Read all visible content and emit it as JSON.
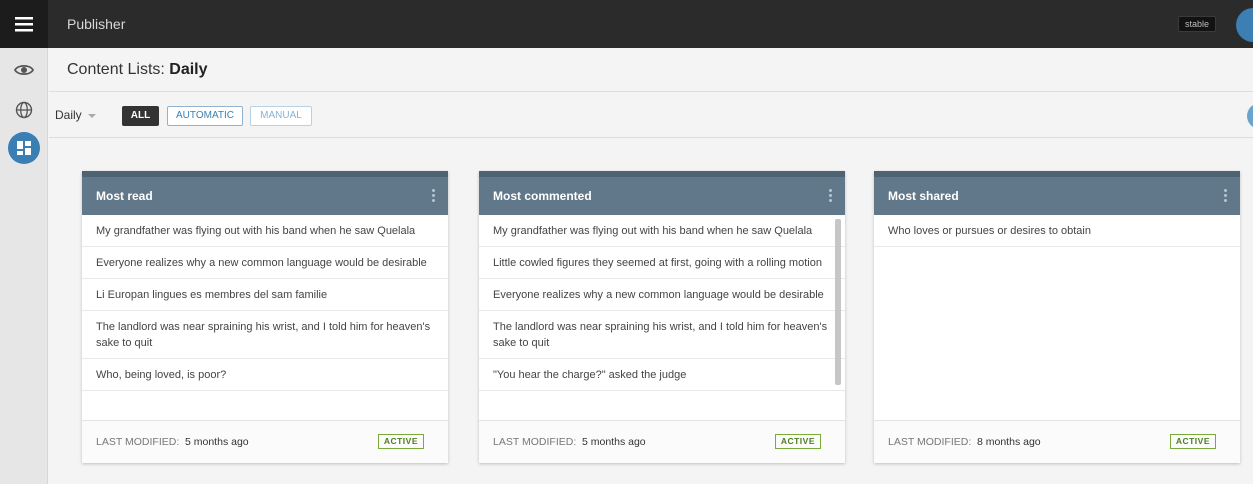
{
  "header": {
    "app_title": "Publisher",
    "env_badge": "stable"
  },
  "page": {
    "title_prefix": "Content Lists: ",
    "title_bold": "Daily"
  },
  "filters": {
    "selected_list": "Daily",
    "buttons": [
      {
        "label": "ALL",
        "active": true
      },
      {
        "label": "AUTOMATIC",
        "active": false
      },
      {
        "label": "MANUAL",
        "active": false,
        "disabled": true
      }
    ]
  },
  "cards": [
    {
      "title": "Most read",
      "items": [
        "My grandfather was flying out with his band when he saw Quelala",
        "Everyone realizes why a new common language would be desirable",
        "Li Europan lingues es membres del sam familie",
        "The landlord was near spraining his wrist, and I told him for heaven's sake to quit",
        "Who, being loved, is poor?"
      ],
      "last_modified_label": "LAST MODIFIED:",
      "last_modified_value": "5 months ago",
      "status": "ACTIVE"
    },
    {
      "title": "Most commented",
      "items": [
        "My grandfather was flying out with his band when he saw Quelala",
        "Little cowled figures they seemed at first, going with a rolling motion",
        "Everyone realizes why a new common language would be desirable",
        "The landlord was near spraining his wrist, and I told him for heaven's sake to quit",
        "\"You hear the charge?\" asked the judge"
      ],
      "last_modified_label": "LAST MODIFIED:",
      "last_modified_value": "5 months ago",
      "status": "ACTIVE"
    },
    {
      "title": "Most shared",
      "items": [
        "Who loves or pursues or desires to obtain"
      ],
      "last_modified_label": "LAST MODIFIED:",
      "last_modified_value": "8 months ago",
      "status": "ACTIVE"
    }
  ],
  "icons": {
    "menu": "hamburger-menu-icon",
    "rail": [
      "eye-icon",
      "globe-icon",
      "dashboard-icon"
    ],
    "card_menu": "more-vert-icon"
  },
  "colors": {
    "topbar": "#2b2b2b",
    "card_header": "#60788a",
    "accent": "#3a7fb4",
    "active_status": "#4e7d1c"
  }
}
